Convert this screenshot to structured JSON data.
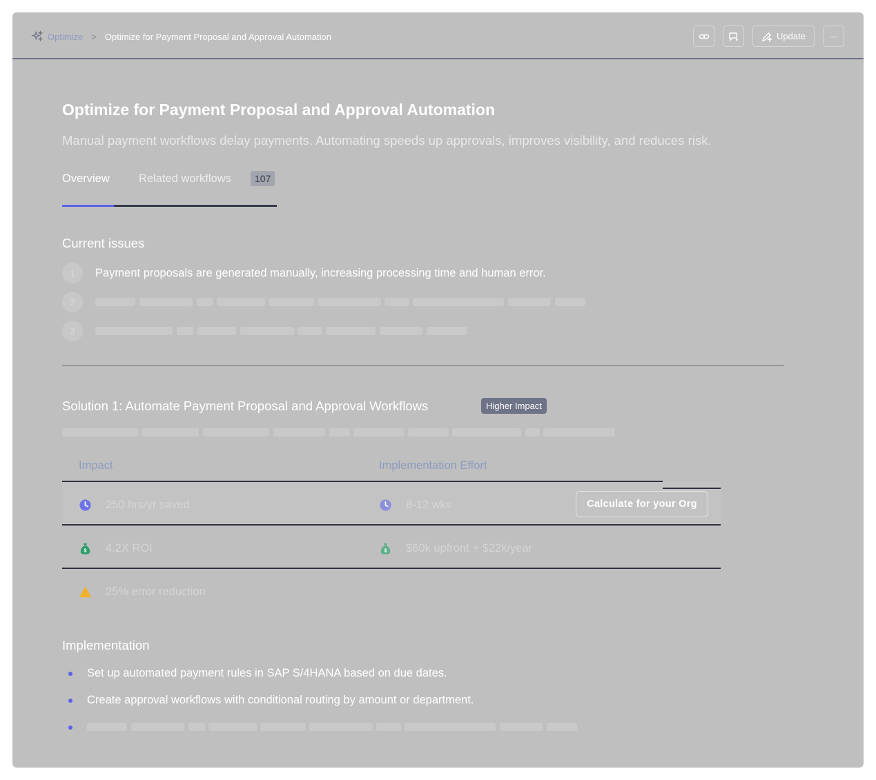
{
  "breadcrumb": {
    "root": "Optimize",
    "separator": ">",
    "current": "Optimize for Payment Proposal and Approval Automation"
  },
  "toolbar": {
    "update_label": "Update",
    "more_label": "···"
  },
  "page": {
    "title": "Optimize for Payment Proposal and Approval Automation",
    "subtitle": "Manual payment workflows delay payments. Automating speeds up approvals, improves visibility, and reduces risk."
  },
  "tabs": {
    "overview": "Overview",
    "related": "Related workflows",
    "related_count": "107"
  },
  "issues": {
    "heading": "Current issues",
    "items": [
      {
        "num": "1",
        "text": "Payment proposals are generated manually, increasing processing time and human error."
      },
      {
        "num": "2",
        "text": ""
      },
      {
        "num": "3",
        "text": ""
      }
    ]
  },
  "solution": {
    "title": "Solution 1: Automate Payment Proposal and Approval Workflows",
    "badge": "Higher Impact",
    "impact_header": "Impact",
    "effort_header": "Implementation Effort",
    "rows": [
      {
        "impact": "250 hrs/yr saved",
        "impact_icon": "clock-icon",
        "effort": "8-12 wks",
        "effort_icon": "clock-icon"
      },
      {
        "impact": "4.2X ROI",
        "impact_icon": "money-bag-icon",
        "effort": "$60k upfront + $22k/year",
        "effort_icon": "money-bag-icon"
      },
      {
        "impact": "25% error reduction",
        "impact_icon": "warning-icon",
        "effort": "",
        "effort_icon": ""
      }
    ],
    "calc_button": "Calculate for your Org"
  },
  "implementation": {
    "heading": "Implementation",
    "items": [
      "Set up automated payment rules in SAP S/4HANA based on due dates.",
      "Create approval workflows with conditional routing by amount or department.",
      ""
    ]
  },
  "colors": {
    "accent": "#5d63e8",
    "overlay": "#bfbfbf",
    "badge": "#6f7387",
    "clock": "#6f73e6",
    "money": "#2e9e6a",
    "warning": "#f2b12b"
  }
}
